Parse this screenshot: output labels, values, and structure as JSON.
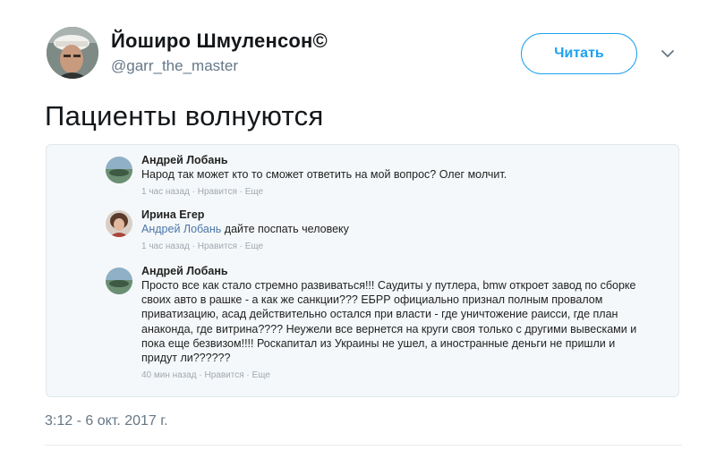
{
  "author": {
    "display_name": "Йоширо Шмуленсон©",
    "handle": "@garr_the_master"
  },
  "follow_button": "Читать",
  "tweet_text": "Пациенты волнуются",
  "timestamp": "3:12 - 6 окт. 2017 г.",
  "embedded_comments": [
    {
      "author": "Андрей Лобань",
      "text": "Народ так может кто то сможет ответить на мой вопрос? Олег молчит.",
      "time": "1 час назад",
      "like": "Нравится",
      "more": "Еще"
    },
    {
      "author": "Ирина Егер",
      "mention": "Андрей Лобань",
      "text": "дайте поспать человеку",
      "time": "1 час назад",
      "like": "Нравится",
      "more": "Еще"
    },
    {
      "author": "Андрей Лобань",
      "text": "Просто все как стало стремно развиваться!!! Саудиты у путлера, bmw откроет завод по сборке своих авто в рашке - а как же санкции??? ЕБРР официально признал полным провалом приватизацию, асад действительно остался при власти - где уничтожение раисси, где план анаконда, где витрина???? Неужели все вернется на круги своя только с другими вывесками и пока еще безвизом!!!! Роскапитал из Украины не ушел, а иностранные деньги не пришли и придут ли??????",
      "time": "40 мин назад",
      "like": "Нравится",
      "more": "Еще"
    }
  ],
  "colors": {
    "accent": "#1da1f2",
    "secondary_text": "#657786",
    "mention": "#4a76a8"
  }
}
